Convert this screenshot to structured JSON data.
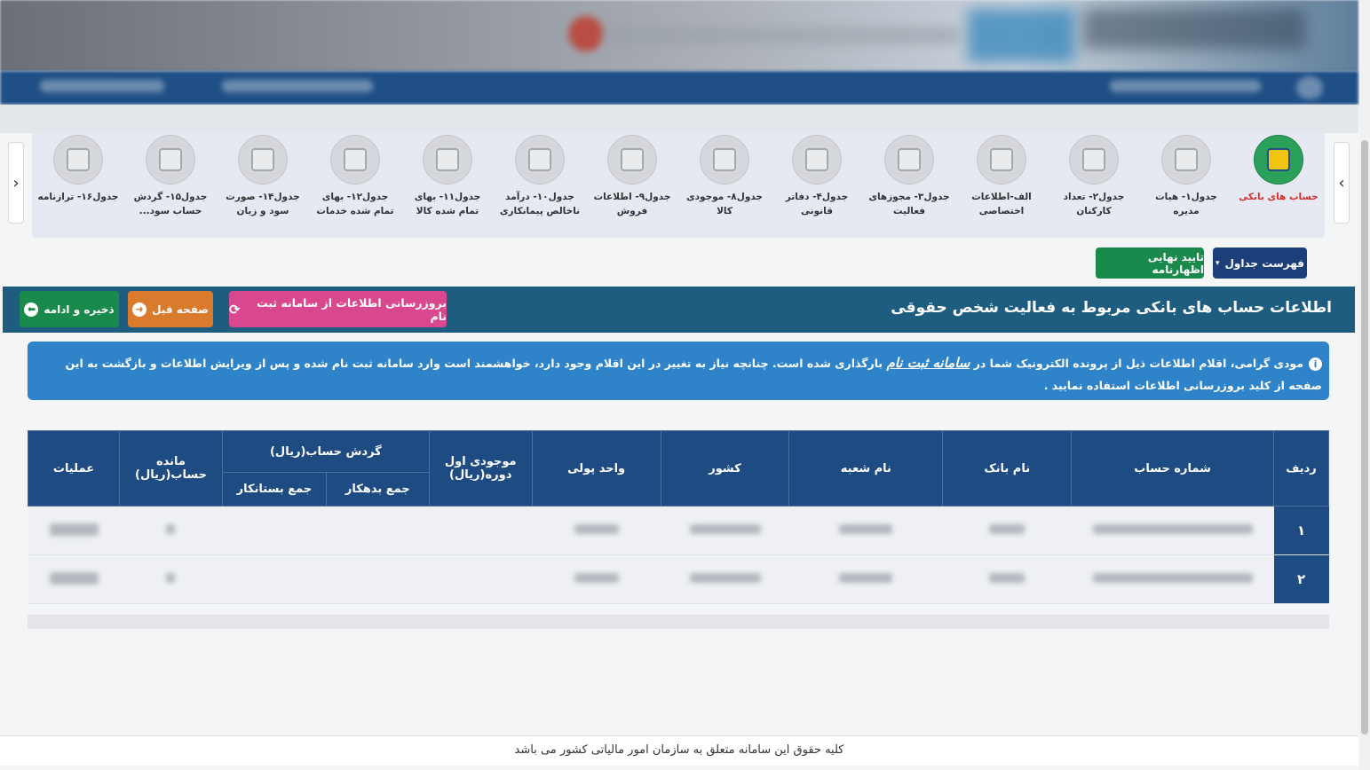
{
  "carousel": {
    "prev_arrow": "‹",
    "next_arrow": "›",
    "tabs": [
      {
        "label": "حساب های بانکی",
        "active": true
      },
      {
        "label": "جدول۱- هیات مدیره"
      },
      {
        "label": "جدول۲- تعداد کارکنان"
      },
      {
        "label": "الف-اطلاعات اختصاصی"
      },
      {
        "label": "جدول۳- مجوزهای فعالیت"
      },
      {
        "label": "جدول۴- دفاتر قانونی"
      },
      {
        "label": "جدول۸- موجودی کالا"
      },
      {
        "label": "جدول۹- اطلاعات فروش"
      },
      {
        "label": "جدول۱۰- درآمد ناخالص پیمانکاری"
      },
      {
        "label": "جدول۱۱- بهای تمام شده کالا"
      },
      {
        "label": "جدول۱۲- بهای تمام شده خدمات"
      },
      {
        "label": "جدول۱۴- صورت سود و زیان"
      },
      {
        "label": "جدول۱۵- گردش حساب سود..."
      },
      {
        "label": "جدول۱۶- ترازنامه"
      }
    ]
  },
  "toolbar": {
    "tables_list": "فهرست جداول",
    "final_confirm": "تایید نهایی اظهارنامه"
  },
  "section": {
    "title": "اطلاعات حساب های بانکی مربوط به فعالیت شخص حقوقی",
    "refresh_button": "بروزرسانی اطلاعات از سامانه ثبت نام",
    "prev_button": "صفحه قبل",
    "save_button": "ذخیره و ادامه"
  },
  "alert": {
    "text_before": "مودی گرامی، اقلام اطلاعات ذیل از پرونده الکترونیک شما در",
    "link": "سامانه ثبت نام",
    "text_after": "بارگذاری شده است. چنانچه نیاز به تغییر در این اقلام وجود دارد، خواهشمند است وارد سامانه ثبت نام شده و پس از ویرایش اطلاعات و بازگشت به این صفحه از کلید بروزرسانی اطلاعات استفاده نمایید ."
  },
  "table": {
    "headers": {
      "row": "ردیف",
      "account_number": "شماره حساب",
      "bank_name": "نام بانک",
      "branch_name": "نام شعبه",
      "country": "کشور",
      "currency": "واحد پولی",
      "opening_balance": "موجودی اول دوره(ریال)",
      "turnover": "گردش حساب(ریال)",
      "debit_total": "جمع بدهکار",
      "credit_total": "جمع بستانکار",
      "balance": "مانده حساب(ریال)",
      "operations": "عملیات"
    },
    "rows": [
      {
        "row": "۱"
      },
      {
        "row": "۲"
      }
    ]
  },
  "footer": {
    "text": "کلیه حقوق این سامانه متعلق به سازمان امور مالیاتی کشور می باشد"
  }
}
